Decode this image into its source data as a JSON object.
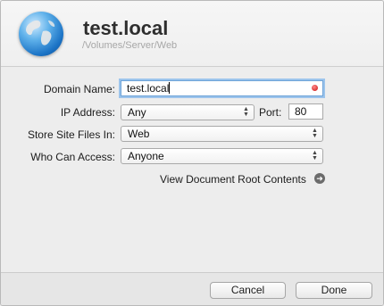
{
  "header": {
    "title": "test.local",
    "path": "/Volumes/Server/Web",
    "icon": "globe-icon"
  },
  "form": {
    "domain_name": {
      "label": "Domain Name:",
      "value": "test.local"
    },
    "ip_address": {
      "label": "IP Address:",
      "value": "Any"
    },
    "port": {
      "label": "Port:",
      "value": "80"
    },
    "store_files": {
      "label": "Store Site Files In:",
      "value": "Web"
    },
    "who_can_access": {
      "label": "Who Can Access:",
      "value": "Anyone"
    },
    "view_root_link": "View Document Root Contents"
  },
  "buttons": {
    "cancel": "Cancel",
    "done": "Done"
  },
  "colors": {
    "focus_ring": "#9cc4ec",
    "clear_button": "#c90f0f"
  }
}
